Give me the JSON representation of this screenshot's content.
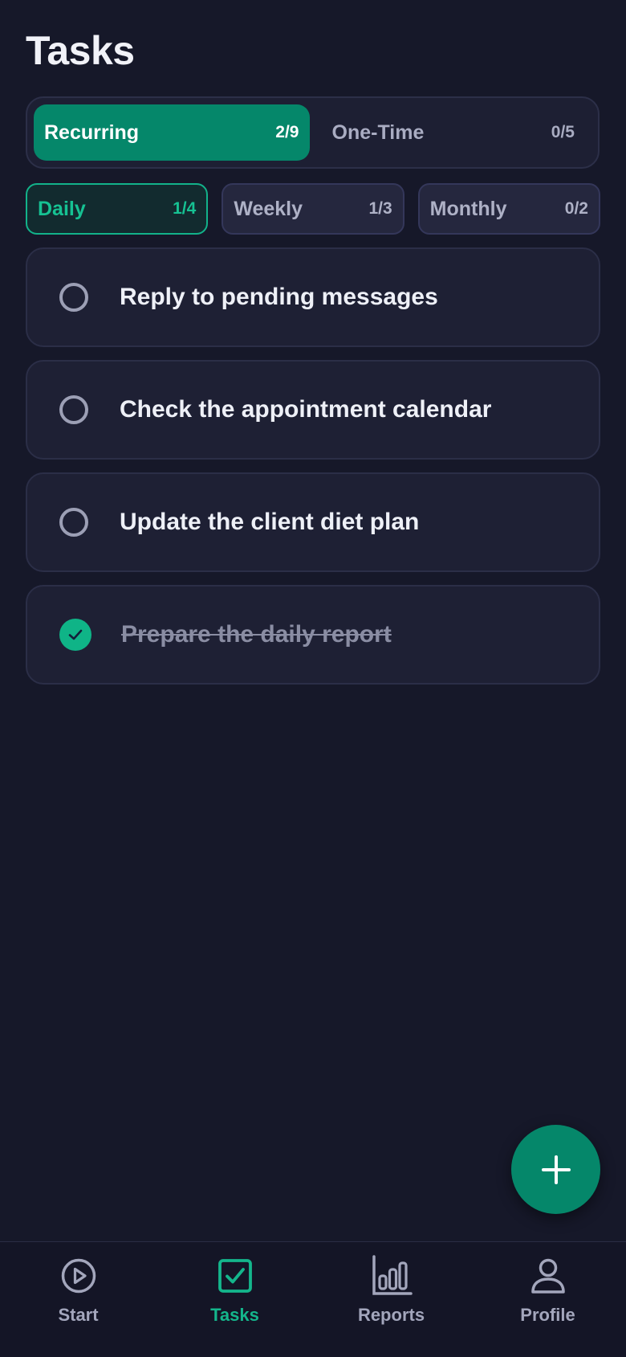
{
  "header": {
    "title": "Tasks"
  },
  "segments": [
    {
      "label": "Recurring",
      "count": "2/9",
      "active": true
    },
    {
      "label": "One-Time",
      "count": "0/5",
      "active": false
    }
  ],
  "frequency": [
    {
      "label": "Daily",
      "count": "1/4",
      "active": true
    },
    {
      "label": "Weekly",
      "count": "1/3",
      "active": false
    },
    {
      "label": "Monthly",
      "count": "0/2",
      "active": false
    }
  ],
  "tasks": [
    {
      "text": "Reply to pending messages",
      "done": false
    },
    {
      "text": "Check the appointment calendar",
      "done": false
    },
    {
      "text": "Update the client diet plan",
      "done": false
    },
    {
      "text": "Prepare the daily report",
      "done": true
    }
  ],
  "fab": {
    "icon": "plus-icon"
  },
  "nav": [
    {
      "label": "Start",
      "icon": "play-circle-icon",
      "active": false
    },
    {
      "label": "Tasks",
      "icon": "checkbox-icon",
      "active": true
    },
    {
      "label": "Reports",
      "icon": "bar-chart-icon",
      "active": false
    },
    {
      "label": "Profile",
      "icon": "user-icon",
      "active": false
    }
  ],
  "colors": {
    "background": "#161829",
    "accent": "#05876a",
    "accent_bright": "#14b68c",
    "card": "#1e2034"
  }
}
